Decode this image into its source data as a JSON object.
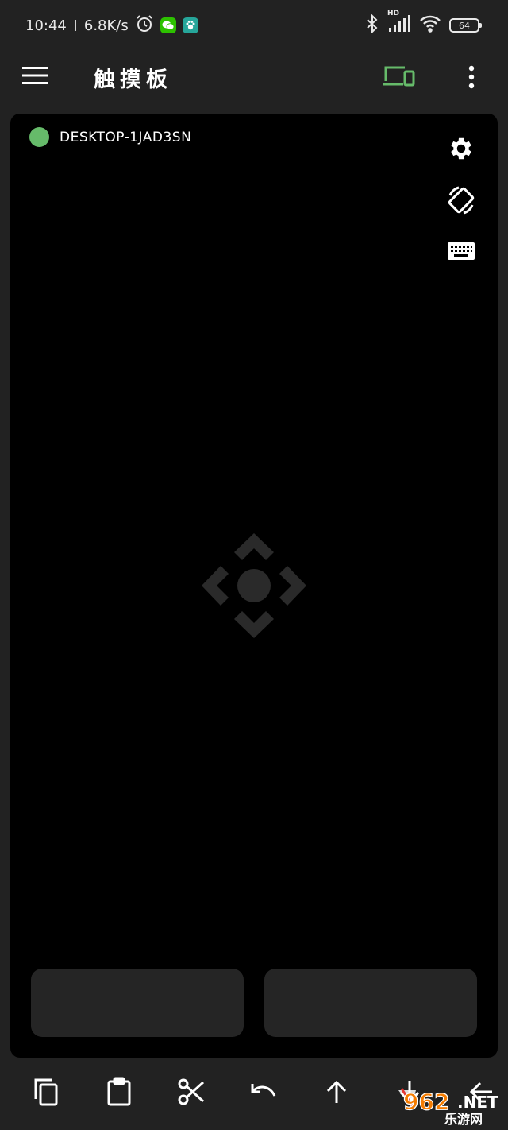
{
  "status_bar": {
    "time": "10:44",
    "net_speed": "6.8K/s",
    "battery": "64",
    "hd_label": "HD"
  },
  "app_bar": {
    "title": "触摸板"
  },
  "touchpad": {
    "device_name": "DESKTOP-1JAD3SN",
    "connected_color": "#66bb6a"
  },
  "toolbar": {
    "icons": [
      "copy-icon",
      "paste-icon",
      "cut-icon",
      "undo-icon",
      "arrow-up-icon",
      "arrow-down-icon",
      "arrow-left-icon"
    ]
  },
  "watermark": {
    "brand": "962",
    "suffix": ".NET",
    "text": "乐游网"
  },
  "colors": {
    "accent": "#66bb6a",
    "background": "#222222",
    "pad": "#000000",
    "button": "#252525"
  }
}
